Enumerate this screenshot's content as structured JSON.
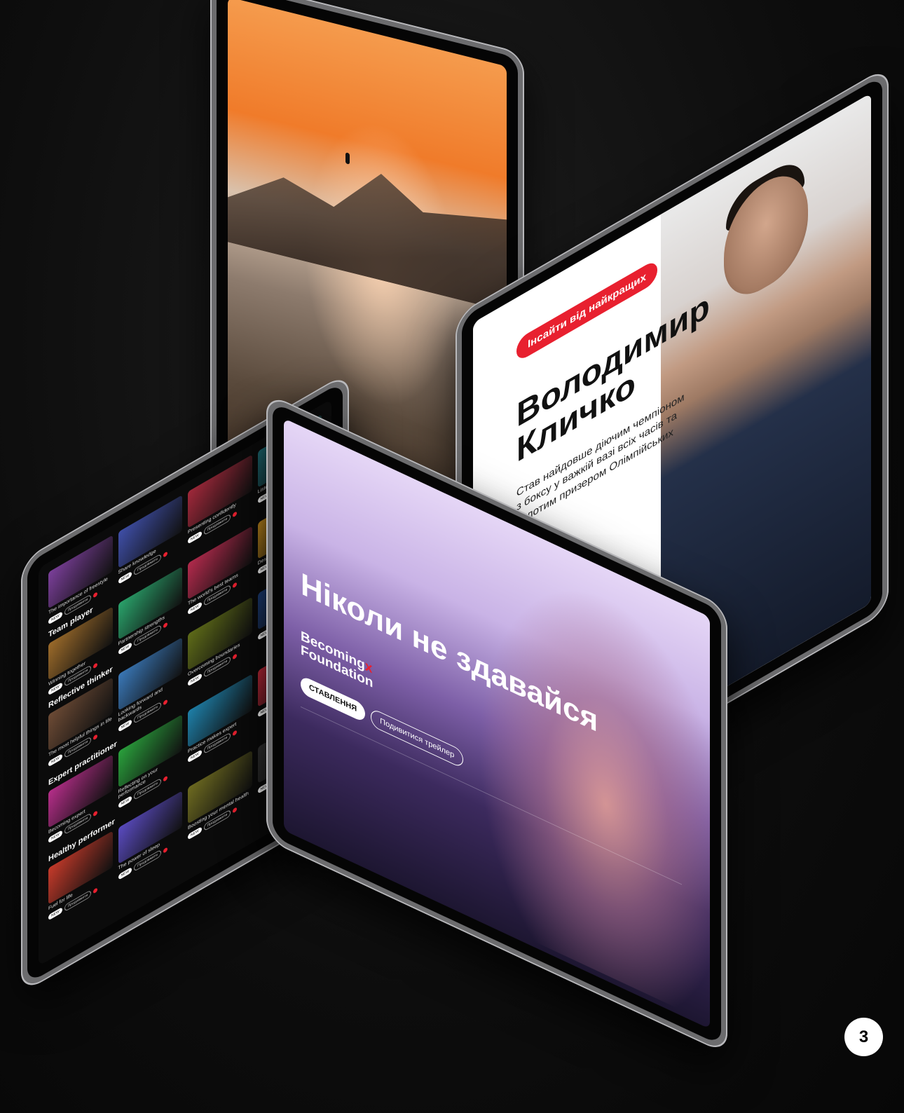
{
  "tablet_orange": {
    "scene": "orange portrait with mountain silhouette"
  },
  "tablet_klychko": {
    "badge": "Інсайти від найкращих",
    "name_line1": "Володимир",
    "name_line2": "Кличко",
    "description": "Став найдовше діючим чемпіоном з боксу у важкій вазі всіх часів та золотим призером Олімпійських ігор."
  },
  "tablet_grid": {
    "sections": [
      {
        "heading": "",
        "items": [
          {
            "title": "The importance of freestyle",
            "color": "#7b3f9a"
          },
          {
            "title": "Share knowledge",
            "color": "#3f4fa8"
          },
          {
            "title": "Presenting confidently",
            "color": "#a0283a"
          },
          {
            "title": "Listening is a listener",
            "color": "#1e6b74"
          }
        ]
      },
      {
        "heading": "Team player",
        "items": [
          {
            "title": "Winning together",
            "color": "#9c6b2a"
          },
          {
            "title": "Partnership strengths",
            "color": "#2aa36b"
          },
          {
            "title": "The world's best teams",
            "color": "#b22a4c"
          },
          {
            "title": "Design for humans",
            "color": "#c28a1e"
          }
        ]
      },
      {
        "heading": "Reflective thinker",
        "items": [
          {
            "title": "The most helpful things in life",
            "color": "#6d4b35"
          },
          {
            "title": "Looking forward and backwards",
            "color": "#3a78b8"
          },
          {
            "title": "Overcoming boundaries",
            "color": "#5e6b18"
          },
          {
            "title": "",
            "color": "#1d3f7a"
          }
        ]
      },
      {
        "heading": "Expert practitioner",
        "items": [
          {
            "title": "Becoming expert",
            "color": "#b52e89"
          },
          {
            "title": "Reflecting on your performance",
            "color": "#2aa13c"
          },
          {
            "title": "Practice makes expert",
            "color": "#1e7fa8"
          },
          {
            "title": "",
            "color": "#c02a3a"
          }
        ]
      },
      {
        "heading": "Healthy performer",
        "items": [
          {
            "title": "Fuel for life",
            "color": "#c53a2a"
          },
          {
            "title": "The power of sleep",
            "color": "#5a4bc0"
          },
          {
            "title": "Boosting your mental health",
            "color": "#6d6a20"
          },
          {
            "title": "",
            "color": "#333333"
          }
        ]
      }
    ],
    "pill_primary": "NEW",
    "pill_secondary": "Продовжити"
  },
  "tablet_front": {
    "title": "Ніколи не здавайся",
    "brand_line1": "Becoming",
    "brand_x": "x",
    "brand_line2": "Foundation",
    "btn_primary": "СТАВЛЕННЯ",
    "btn_secondary": "Подивитися трейлер"
  },
  "page_number": "3",
  "colors": {
    "accent": "#e8202f"
  }
}
